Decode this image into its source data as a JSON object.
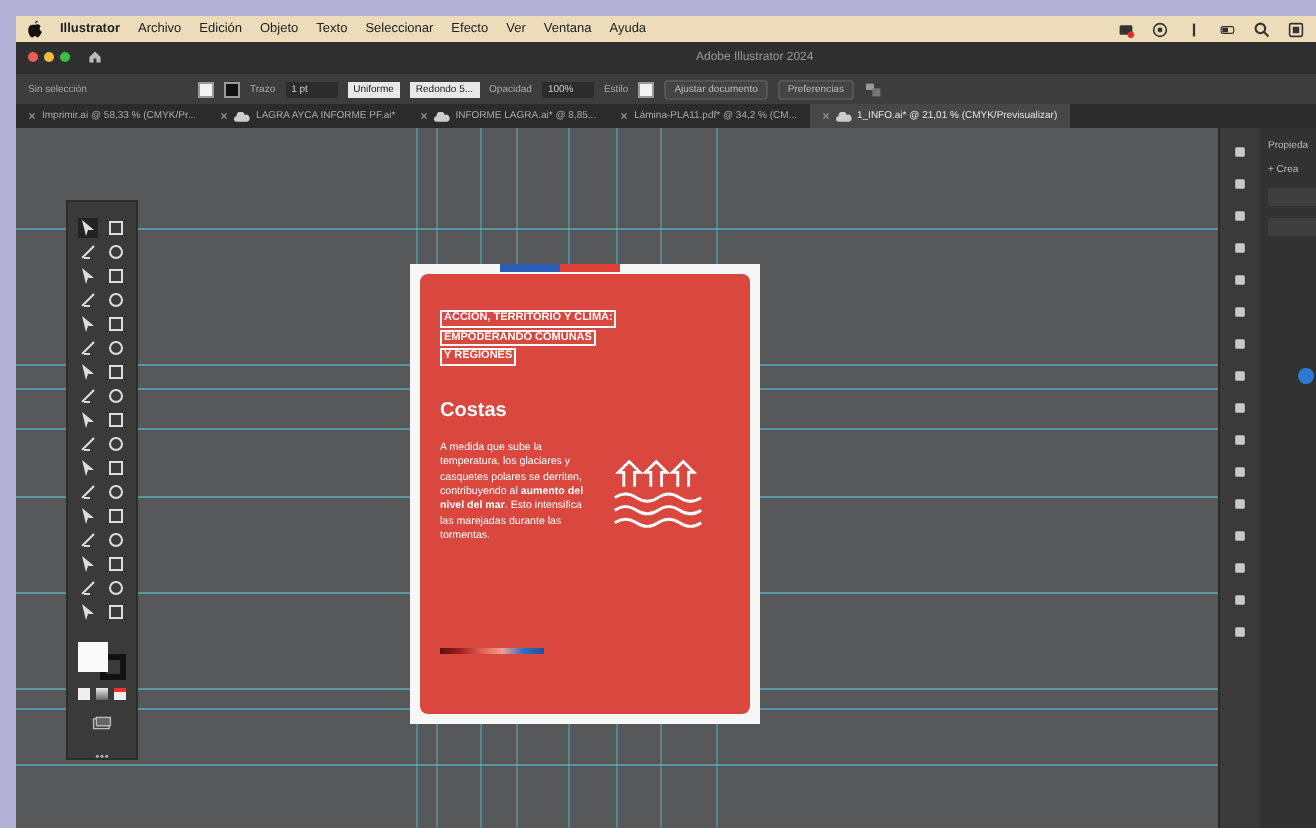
{
  "menu_bar": {
    "items": [
      "Illustrator",
      "Archivo",
      "Edición",
      "Objeto",
      "Texto",
      "Seleccionar",
      "Efecto",
      "Ver",
      "Ventana",
      "Ayuda"
    ]
  },
  "window": {
    "title": "Adobe Illustrator 2024"
  },
  "control_bar": {
    "selection": "Sin selección",
    "stroke_label": "Trazo",
    "stroke_weight": "1 pt",
    "profile": "Uniforme",
    "brush": "Redondo 5...",
    "opacity_label": "Opacidad",
    "opacity": "100%",
    "style_label": "Estilo",
    "buttons": [
      "Ajustar documento",
      "Preferencias"
    ]
  },
  "tabs": [
    {
      "label": "Imprimir.ai @ 58,33 % (CMYK/Pr...",
      "cloud": false,
      "selected": false
    },
    {
      "label": "LAGRA AYCA INFORME PF.ai*",
      "cloud": true,
      "selected": false
    },
    {
      "label": "INFORME LAGRA.ai* @ 8,85...",
      "cloud": true,
      "selected": false
    },
    {
      "label": "Lámina-PLA11.pdf* @ 34,2 % (CM...",
      "cloud": false,
      "selected": false
    },
    {
      "label": "1_INFO.ai* @ 21,01 % (CMYK/Previsualizar)",
      "cloud": true,
      "selected": true
    }
  ],
  "artboard": {
    "tag_lines": [
      "ACCIÓN, TERRITORIO Y CLIMA:",
      "EMPODERANDO COMUNAS",
      "Y REGIONES"
    ],
    "heading": "Costas",
    "body": "A medida que sube la temperatura, los glaciares y casquetes polares se derriten, contribuyendo al **aumento del nivel del mar**. Esto intensifica las marejadas durante las tormentas."
  },
  "properties_panel": {
    "title": "Propieda",
    "new_label": "+ Crea"
  }
}
